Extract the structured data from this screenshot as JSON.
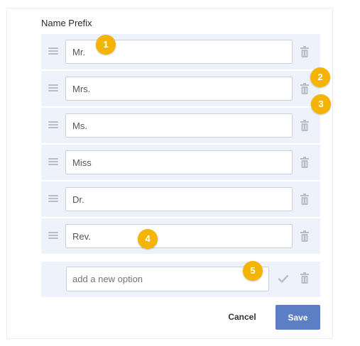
{
  "field": {
    "title": "Name Prefix"
  },
  "options": [
    {
      "value": "Mr."
    },
    {
      "value": "Mrs."
    },
    {
      "value": "Ms."
    },
    {
      "value": "Miss"
    },
    {
      "value": "Dr."
    },
    {
      "value": "Rev."
    }
  ],
  "new_option": {
    "placeholder": "add a new option",
    "value": ""
  },
  "buttons": {
    "cancel": "Cancel",
    "save": "Save"
  },
  "badges": [
    "1",
    "2",
    "3",
    "4",
    "5"
  ],
  "icons": {
    "drag": "drag-handle-icon",
    "delete": "trash-icon",
    "confirm": "checkmark-icon"
  },
  "colors": {
    "primary": "#5b7ec5",
    "row_bg": "#eef2fb",
    "badge": "#f5b400"
  }
}
